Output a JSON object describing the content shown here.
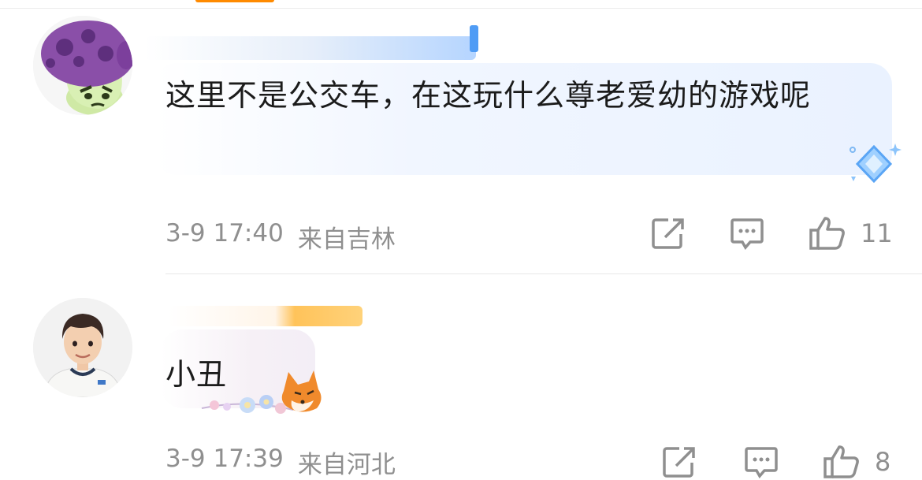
{
  "comments": [
    {
      "avatar_icon": "mushroom-plant-avatar",
      "text": "这里不是公交车，在这玩什么尊老爱幼的游戏呢",
      "time": "3-9 17:40",
      "location": "来自吉林",
      "likes": "11"
    },
    {
      "avatar_icon": "young-man-avatar",
      "text": "小丑",
      "time": "3-9 17:39",
      "location": "来自河北",
      "likes": "8"
    }
  ],
  "colors": {
    "accent": "#ff8a00",
    "meta": "#8f8f8f",
    "text": "#1b1b1b",
    "bubble": "#eef5ff"
  },
  "icons": [
    "share-icon",
    "comment-icon",
    "like-icon",
    "diamond-badge-icon"
  ]
}
